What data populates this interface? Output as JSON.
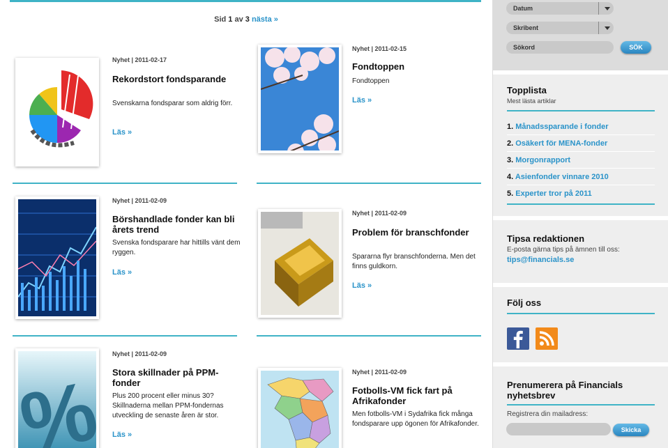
{
  "pager": {
    "prefix": "Sid ",
    "current": "1",
    "middle": " av ",
    "total": "3",
    "next": "nästa »"
  },
  "articles": [
    {
      "meta": "Nyhet | 2011-02-17",
      "title": "Rekordstort fondsparande",
      "desc": "Svenskarna fondsparar som aldrig förr.",
      "more": "Läs »"
    },
    {
      "meta": "Nyhet | 2011-02-15",
      "title": "Fondtoppen",
      "desc": "Fondtoppen",
      "more": "Läs »"
    },
    {
      "meta": "Nyhet | 2011-02-09",
      "title": "Börshandlade fonder kan bli årets trend",
      "desc": "Svenska fondsparare har hittills vänt dem ryggen.",
      "more": "Läs »"
    },
    {
      "meta": "Nyhet | 2011-02-09",
      "title": "Problem för branschfonder",
      "desc": "Spararna flyr branschfonderna. Men det finns guldkorn.",
      "more": "Läs »"
    },
    {
      "meta": "Nyhet | 2011-02-09",
      "title": "Stora skillnader på PPM-fonder",
      "desc": "Plus 200 procent eller minus 30? Skillnaderna mellan PPM-fondernas utveckling de senaste åren är stor.",
      "more": "Läs »"
    },
    {
      "meta": "Nyhet | 2011-02-09",
      "title": "Fotbolls-VM fick fart på Afrikafonder",
      "desc": "Men fotbolls-VM i Sydafrika fick många fondsparare upp ögonen för Afrikafonder.",
      "more": ""
    }
  ],
  "search": {
    "date_label": "Datum",
    "writer_label": "Skribent",
    "query_placeholder": "Sökord",
    "button": "SÖK"
  },
  "toplist": {
    "title": "Topplista",
    "subtitle": "Mest lästa artiklar",
    "items": [
      {
        "n": "1.",
        "label": "Månadssparande i fonder"
      },
      {
        "n": "2.",
        "label": "Osäkert för MENA-fonder"
      },
      {
        "n": "3.",
        "label": "Morgonrapport"
      },
      {
        "n": "4.",
        "label": "Asienfonder vinnare 2010"
      },
      {
        "n": "5.",
        "label": "Experter tror på 2011"
      }
    ]
  },
  "tips": {
    "title": "Tipsa redaktionen",
    "text": "E-posta gärna tips på ämnen till oss:",
    "email": "tips@financials.se"
  },
  "follow": {
    "title": "Följ oss",
    "icons": [
      "facebook-icon",
      "rss-icon"
    ]
  },
  "newsletter": {
    "title_line1": "Prenumerera på Financials",
    "title_line2": "nyhetsbrev",
    "label": "Registrera din mailadress:",
    "button": "Skicka"
  },
  "colors": {
    "accent": "#3fb3c6",
    "link": "#2a93c9",
    "button": "#2a86c0"
  }
}
